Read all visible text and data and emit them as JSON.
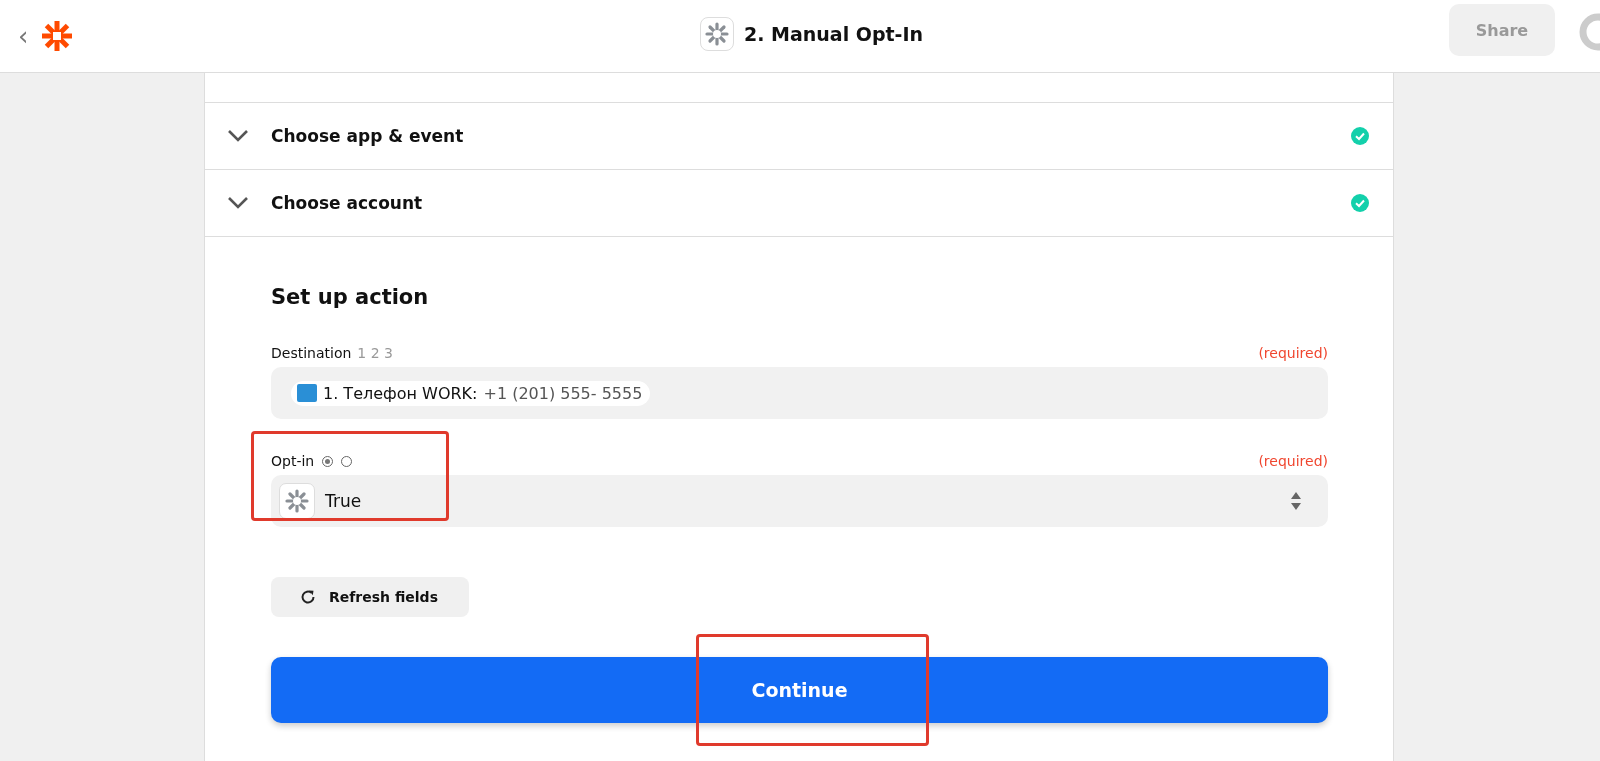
{
  "header": {
    "back": "‹",
    "title": "2. Manual Opt-In",
    "share_button": {
      "label": "Share",
      "disabled": true
    }
  },
  "sections": [
    {
      "title": "Choose app & event",
      "expanded": false,
      "complete": true
    },
    {
      "title": "Choose account",
      "expanded": false,
      "complete": true
    }
  ],
  "setup": {
    "heading": "Set up action",
    "fields": [
      {
        "kind": "chips",
        "label": "Destination",
        "hint": "1 2 3",
        "required": "(required)",
        "highlighted": false,
        "chip": {
          "label": "1. Телефон WORK:",
          "value": "+1 (201) 555- 5555"
        }
      },
      {
        "kind": "select",
        "label": "Opt-in",
        "mode_options": [
          {
            "selected": true
          },
          {
            "selected": false
          }
        ],
        "required": "(required)",
        "highlighted": true,
        "value": "True"
      }
    ],
    "refresh_button": "Refresh fields",
    "continue_button": {
      "label": "Continue",
      "highlighted": true
    }
  }
}
